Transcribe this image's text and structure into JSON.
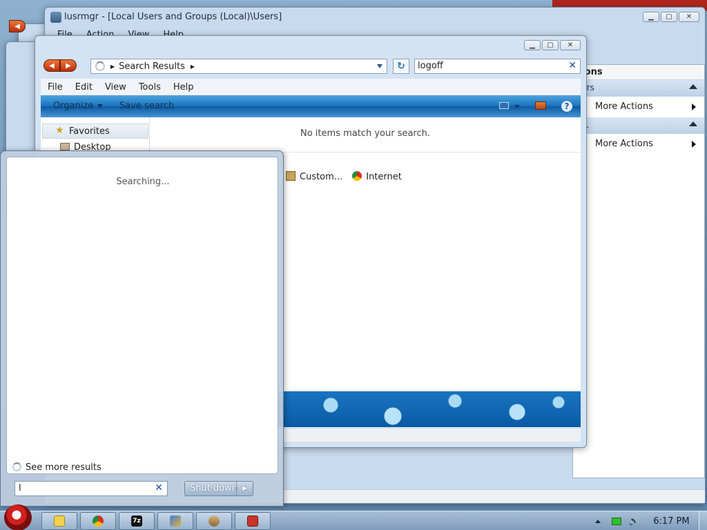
{
  "lusrmgr": {
    "title": "lusrmgr - [Local Users and Groups (Local)\\Users]",
    "menu": [
      "File",
      "Action",
      "View",
      "Help"
    ],
    "actions": {
      "header": "tions",
      "sections": [
        {
          "label": "sers",
          "item": "More Actions"
        },
        {
          "label": "DL",
          "item": "More Actions"
        }
      ]
    }
  },
  "explorer": {
    "address": "Search Results",
    "search_value": "logoff",
    "menu": [
      "File",
      "Edit",
      "View",
      "Tools",
      "Help"
    ],
    "organize": "Organize",
    "save_search": "Save search",
    "favorites": "Favorites",
    "desktop": "Desktop",
    "no_items": "No items match your search.",
    "search_again": [
      "Custom...",
      "Internet"
    ]
  },
  "startmenu": {
    "status": "Searching...",
    "see_more": "See more results",
    "search_value": "l",
    "shutdown": "Shut down"
  },
  "taskbar": {
    "clock": "6:17 PM"
  },
  "colors": {
    "command_bar": "#1a74bf",
    "nav_orange": "#d9531e",
    "taskbar": "#8fa9c6"
  }
}
